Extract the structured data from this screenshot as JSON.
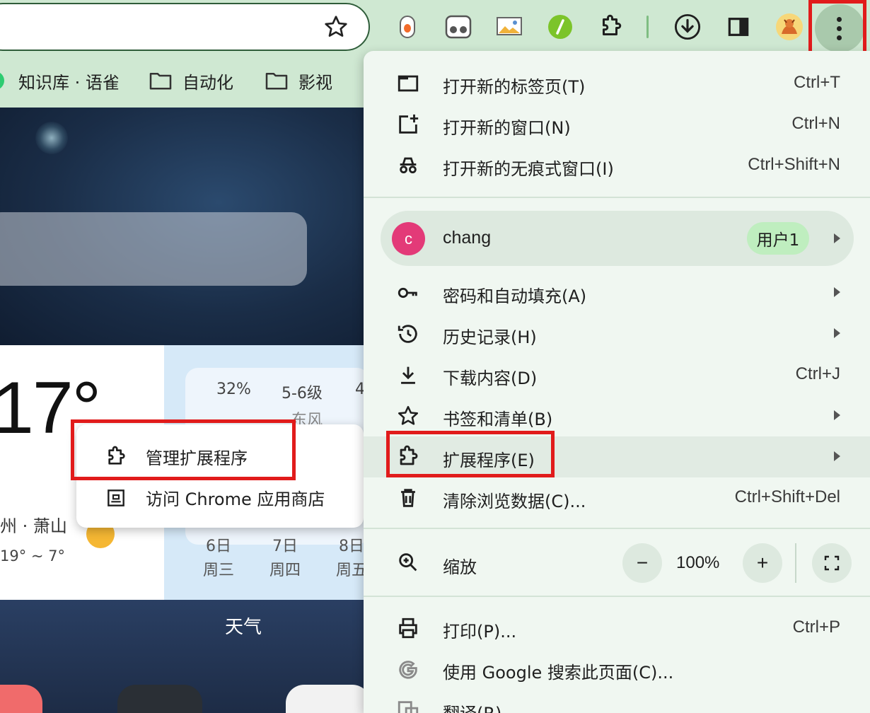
{
  "bookmarks": [
    {
      "label": "知识库 · 语雀",
      "icon": "yuque-logo-icon"
    },
    {
      "label": "自动化",
      "icon": "folder-icon"
    },
    {
      "label": "影视",
      "icon": "folder-icon"
    }
  ],
  "weather": {
    "temperature": "17°",
    "city": "州 · 萧山",
    "range": "19° ~ 7°",
    "humidity": "32%",
    "wind": "5-6级",
    "wind_more": "4",
    "wind_label_partial": "东风",
    "days": [
      {
        "date": "6日",
        "weekday": "周三"
      },
      {
        "date": "7日",
        "weekday": "周四"
      },
      {
        "date": "8日",
        "weekday": "周五"
      }
    ],
    "caption": "天气"
  },
  "submenu": {
    "items": [
      {
        "label": "管理扩展程序",
        "icon": "puzzle-icon"
      },
      {
        "label": "访问 Chrome 应用商店",
        "icon": "webstore-icon"
      }
    ]
  },
  "menu": {
    "new_tab": {
      "label": "打开新的标签页(T)",
      "shortcut": "Ctrl+T"
    },
    "new_window": {
      "label": "打开新的窗口(N)",
      "shortcut": "Ctrl+N"
    },
    "incognito": {
      "label": "打开新的无痕式窗口(I)",
      "shortcut": "Ctrl+Shift+N"
    },
    "profile": {
      "initial": "c",
      "name": "chang",
      "badge": "用户1"
    },
    "passwords": {
      "label": "密码和自动填充(A)"
    },
    "history": {
      "label": "历史记录(H)"
    },
    "downloads": {
      "label": "下载内容(D)",
      "shortcut": "Ctrl+J"
    },
    "bookmarks": {
      "label": "书签和清单(B)"
    },
    "extensions": {
      "label": "扩展程序(E)"
    },
    "clear_data": {
      "label": "清除浏览数据(C)...",
      "shortcut": "Ctrl+Shift+Del"
    },
    "zoom": {
      "label": "缩放",
      "minus": "−",
      "value": "100%",
      "plus": "+"
    },
    "print": {
      "label": "打印(P)...",
      "shortcut": "Ctrl+P"
    },
    "google_search": {
      "label": "使用 Google 搜索此页面(C)..."
    },
    "translate": {
      "label": "翻译(R)"
    }
  },
  "colors": {
    "highlight_red": "#e11b1b",
    "menu_bg": "#f0f7f1",
    "avatar": "#e33a78",
    "badge": "#bfeebf"
  }
}
